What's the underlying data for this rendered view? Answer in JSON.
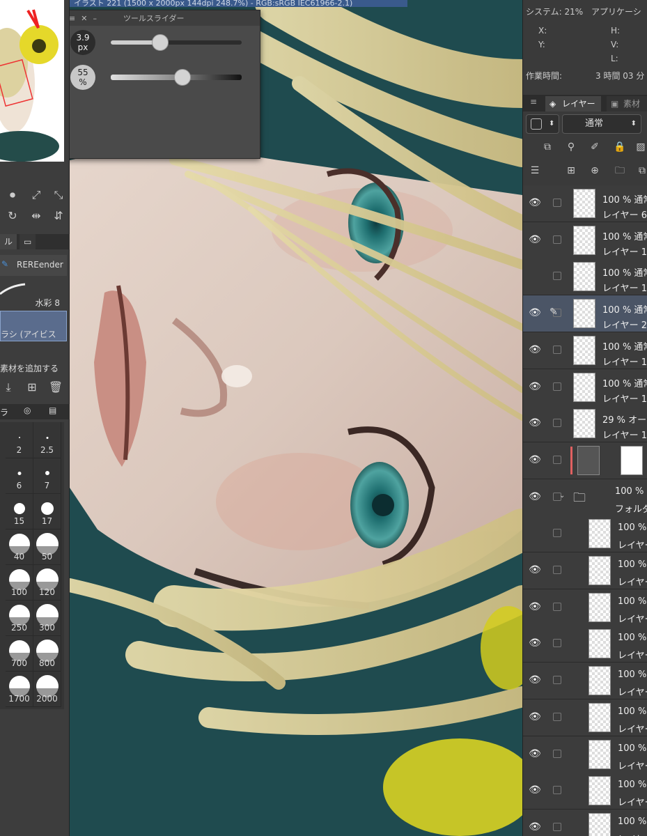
{
  "document": {
    "title": "イラスト 221 (1500 x 2000px 144dpi 248.7%) - RGB:sRGB IEC61966-2.1)"
  },
  "tool_slider": {
    "title": "ツールスライダー",
    "size": {
      "value_line1": "3.9",
      "value_line2": "px",
      "percent": 38
    },
    "opacity": {
      "value_line1": "55",
      "value_line2": "%",
      "percent": 55
    }
  },
  "left_panel": {
    "tab_label": "ル",
    "brush_group": "REREender",
    "brushes": [
      {
        "name": "水彩 8"
      },
      {
        "name": "ラシ (アイビス"
      }
    ],
    "add_material": "素材を追加する",
    "sub_tab": "ラ",
    "sizes": [
      "2",
      "2.5",
      "6",
      "7",
      "15",
      "17",
      "40",
      "50",
      "100",
      "120",
      "250",
      "300",
      "700",
      "800",
      "1700",
      "2000"
    ]
  },
  "info_panel": {
    "system": "システム: 21%",
    "app": "アプリケーシ",
    "x": "X:",
    "y": "Y:",
    "h": "H:",
    "v": "V:",
    "l": "L:",
    "work_time_label": "作業時間:",
    "work_time_value": "3 時間 03 分"
  },
  "layer_panel": {
    "tab_layer": "レイヤー",
    "tab_material": "素材[",
    "blend_mode": "通常",
    "layers": [
      {
        "l1": "100 % 通常",
        "l2": "レイヤー 6",
        "visible": true,
        "selected": false,
        "indent": false
      },
      {
        "l1": "100 % 通常",
        "l2": "レイヤー 1",
        "visible": true,
        "selected": false,
        "indent": false
      },
      {
        "l1": "100 % 通常",
        "l2": "レイヤー 1",
        "visible": false,
        "selected": false,
        "indent": false
      },
      {
        "l1": "100 % 通常",
        "l2": "レイヤー 2",
        "visible": true,
        "selected": true,
        "indent": false
      },
      {
        "l1": "100 % 通常",
        "l2": "レイヤー 1",
        "visible": true,
        "selected": false,
        "indent": false
      },
      {
        "l1": "100 % 通常",
        "l2": "レイヤー 1",
        "visible": true,
        "selected": false,
        "indent": false
      },
      {
        "l1": "29 % オー",
        "l2": "レイヤー 1",
        "visible": true,
        "selected": false,
        "indent": false
      },
      {
        "l1": "",
        "l2": "",
        "visible": true,
        "selected": false,
        "indent": false,
        "mask": true
      },
      {
        "l1": "100 %",
        "l2": "フォルダ",
        "visible": true,
        "selected": false,
        "indent": false,
        "folder": true
      },
      {
        "l1": "100 %",
        "l2": "レイヤー",
        "visible": false,
        "selected": false,
        "indent": true
      },
      {
        "l1": "100 %",
        "l2": "レイヤー",
        "visible": true,
        "selected": false,
        "indent": true
      },
      {
        "l1": "100 %",
        "l2": "レイヤー",
        "visible": true,
        "selected": false,
        "indent": true
      },
      {
        "l1": "100 %",
        "l2": "レイヤー",
        "visible": true,
        "selected": false,
        "indent": true
      },
      {
        "l1": "100 %",
        "l2": "レイヤー",
        "visible": true,
        "selected": false,
        "indent": true
      },
      {
        "l1": "100 %",
        "l2": "レイヤー",
        "visible": true,
        "selected": false,
        "indent": true
      },
      {
        "l1": "100 %",
        "l2": "レイヤー",
        "visible": true,
        "selected": false,
        "indent": true
      },
      {
        "l1": "100 %",
        "l2": "レイヤー",
        "visible": true,
        "selected": false,
        "indent": true
      },
      {
        "l1": "100 %",
        "l2": "レイヤー",
        "visible": true,
        "selected": false,
        "indent": true
      }
    ]
  },
  "icons": [
    "eye-icon",
    "pen-icon",
    "folder-icon",
    "close-icon",
    "menu-icon",
    "layers-icon",
    "lock-icon",
    "trash-icon"
  ],
  "colors": {
    "accent": "#4a90d9",
    "selected_layer": "#4b5566",
    "panel": "#3a3a3a"
  }
}
